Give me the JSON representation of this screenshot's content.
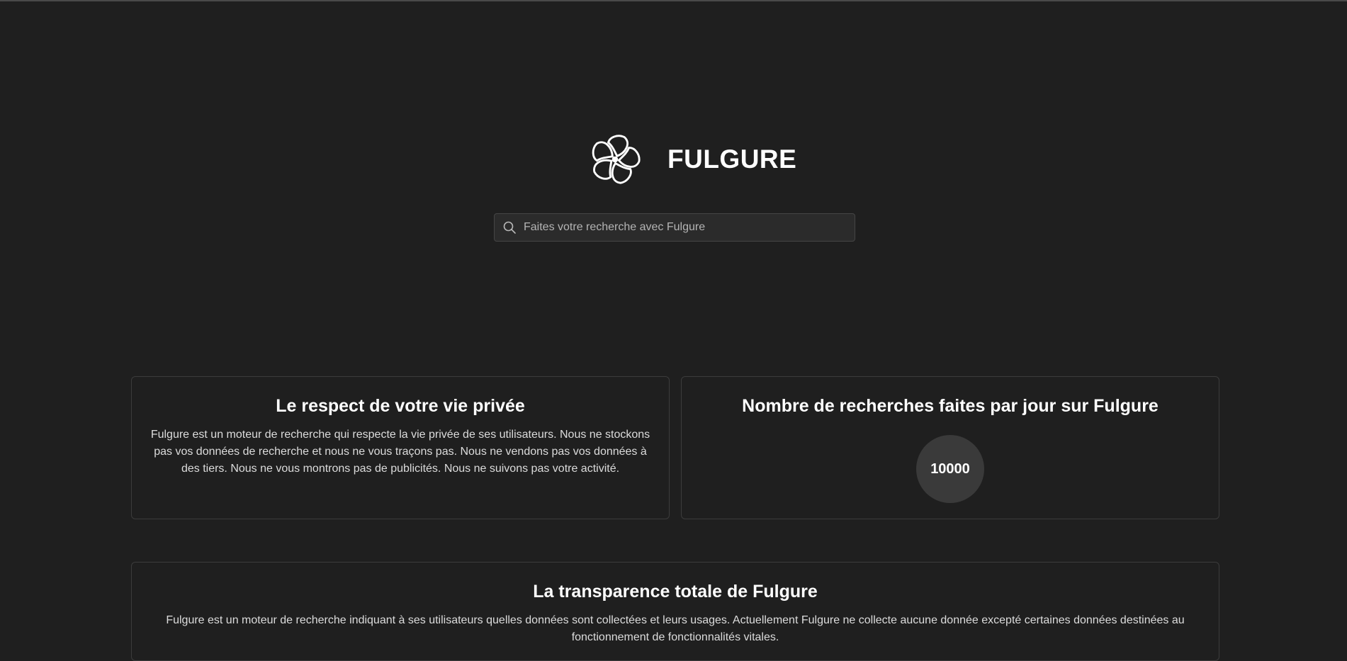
{
  "brand": {
    "name": "FULGURE",
    "logo_icon": "swirl-flower-logo-icon"
  },
  "search": {
    "placeholder": "Faites votre recherche avec Fulgure",
    "value": "",
    "icon": "search-icon"
  },
  "privacy_card": {
    "title": "Le respect de votre vie privée",
    "text": "Fulgure est un moteur de recherche qui respecte la vie privée de ses utilisateurs. Nous ne stockons pas vos données de recherche et nous ne vous traçons pas. Nous ne vendons pas vos données à des tiers. Nous ne vous montrons pas de publicités. Nous ne suivons pas votre activité."
  },
  "count_card": {
    "title": "Nombre de recherches faites par jour sur Fulgure",
    "value": "10000"
  },
  "transparency_card": {
    "title": "La transparence totale de Fulgure",
    "text": "Fulgure est un moteur de recherche indiquant à ses utilisateurs quelles données sont collectées et leurs usages. Actuellement Fulgure ne collecte aucune donnée excepté certaines données destinées au fonctionnement de fonctionnalités vitales."
  },
  "colors": {
    "background": "#1f1f1f",
    "card_border": "#3c3c3c",
    "counter_bg": "#3a3a3a",
    "text": "#ffffff"
  }
}
